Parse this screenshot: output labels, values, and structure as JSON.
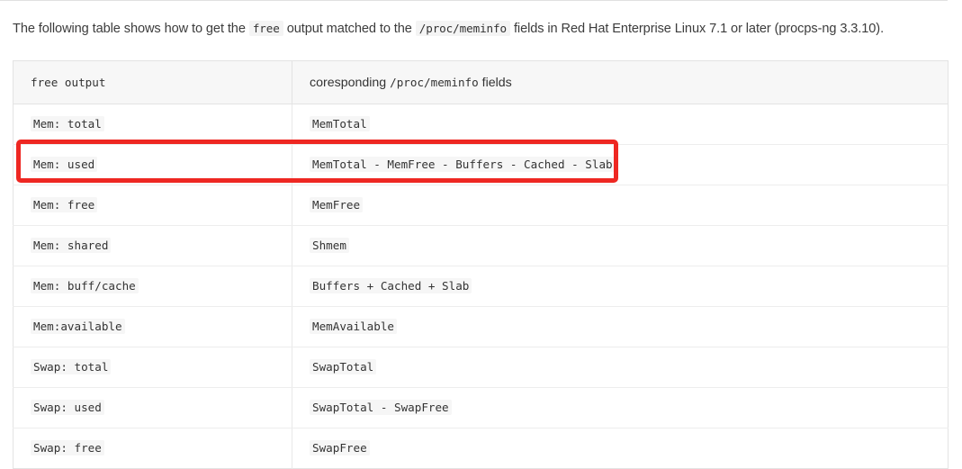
{
  "intro": {
    "part1": "The following table shows how to get the ",
    "code1": "free",
    "part2": " output matched to the ",
    "code2": "/proc/meminfo",
    "part3": " fields in Red Hat Enterprise Linux 7.1 or later (procps-ng 3.3.10)."
  },
  "table": {
    "headers": {
      "col1": "free output",
      "col2_prefix": "coresponding ",
      "col2_code": "/proc/meminfo",
      "col2_suffix": " fields"
    },
    "rows": [
      {
        "free_output": "Mem: total",
        "meminfo_field": "MemTotal"
      },
      {
        "free_output": "Mem: used",
        "meminfo_field": "MemTotal - MemFree - Buffers - Cached - Slab"
      },
      {
        "free_output": "Mem: free",
        "meminfo_field": "MemFree"
      },
      {
        "free_output": "Mem: shared",
        "meminfo_field": "Shmem"
      },
      {
        "free_output": "Mem: buff/cache",
        "meminfo_field": "Buffers + Cached + Slab"
      },
      {
        "free_output": "Mem:available",
        "meminfo_field": "MemAvailable"
      },
      {
        "free_output": "Swap: total",
        "meminfo_field": "SwapTotal"
      },
      {
        "free_output": "Swap: used",
        "meminfo_field": "SwapTotal - SwapFree"
      },
      {
        "free_output": "Swap: free",
        "meminfo_field": "SwapFree"
      }
    ]
  },
  "annotation": {
    "highlight_color": "#ee2722",
    "highlighted_row_index": 1
  }
}
